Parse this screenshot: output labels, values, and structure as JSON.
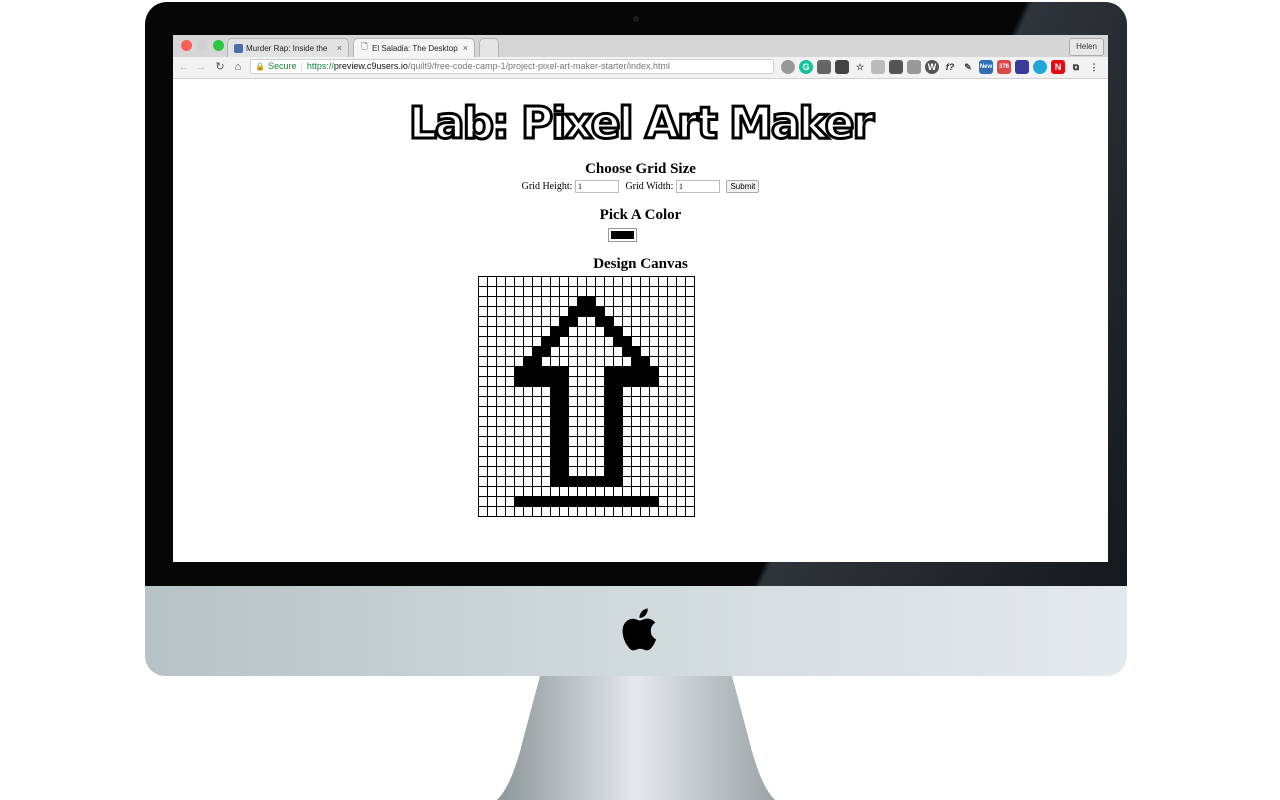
{
  "browser": {
    "profile_name": "Helen",
    "tabs": [
      {
        "title": "Murder Rap: Inside the",
        "active": false
      },
      {
        "title": "El Saladia: The Desktop Ve",
        "active": true
      }
    ],
    "address": {
      "secure_label": "Secure",
      "scheme": "https://",
      "host": "preview.c9users.io",
      "path": "/quilt9/free-code-camp-1/project-pixel-art-maker-starter/index.html"
    },
    "extension_badges": {
      "new": "New",
      "count": "376"
    }
  },
  "page": {
    "title": "Lab: Pixel Art Maker",
    "grid_heading": "Choose Grid Size",
    "height_label": "Grid Height:",
    "height_value": "1",
    "width_label": "Grid Width:",
    "width_value": "1",
    "submit_label": "Submit",
    "color_heading": "Pick A Color",
    "selected_color": "#000000",
    "canvas_heading": "Design Canvas",
    "canvas_grid": [
      "........................",
      "........................",
      "...........##...........",
      "..........####..........",
      ".........##..##.........",
      "........##....##........",
      ".......##......##.......",
      "......##........##......",
      ".....##..........##.....",
      "....######....######....",
      "....######....######....",
      "........##....##........",
      "........##....##........",
      "........##....##........",
      "........##....##........",
      "........##....##........",
      "........##....##........",
      "........##....##........",
      "........##....##........",
      "........##....##........",
      "........########........",
      "........................",
      "....################....",
      "........................"
    ]
  }
}
